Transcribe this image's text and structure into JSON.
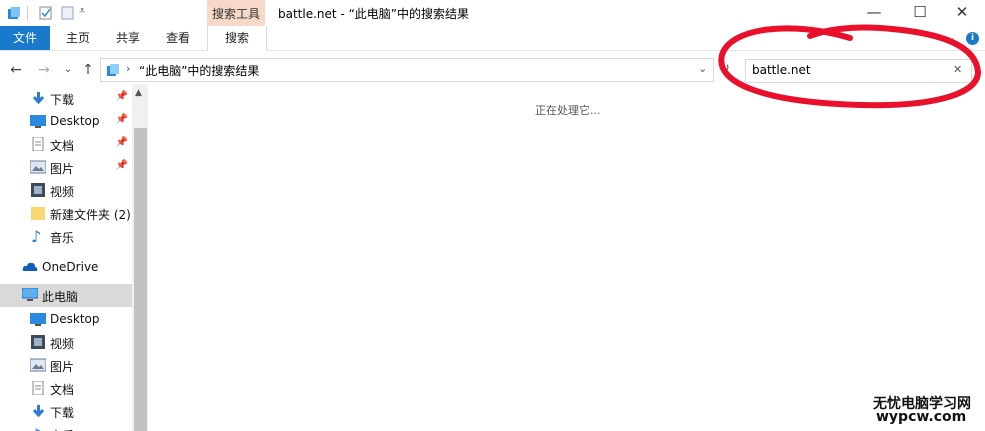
{
  "window": {
    "title": "battle.net - “此电脑”中的搜索结果",
    "context_tab": "搜索工具",
    "controls": {
      "minimize": "—",
      "maximize": "☐",
      "close": "✕"
    }
  },
  "ribbon": {
    "tabs": [
      "文件",
      "主页",
      "共享",
      "查看",
      "搜索"
    ],
    "expand_glyph": "⌄"
  },
  "address": {
    "path": "“此电脑”中的搜索结果",
    "search_value": "battle.net",
    "clear_glyph": "✕"
  },
  "nav_pane": {
    "quick_access": [
      {
        "label": "下载",
        "icon": "download-icon",
        "pinned": true
      },
      {
        "label": "Desktop",
        "icon": "desktop-icon",
        "pinned": true
      },
      {
        "label": "文档",
        "icon": "document-icon",
        "pinned": true
      },
      {
        "label": "图片",
        "icon": "pictures-icon",
        "pinned": true
      },
      {
        "label": "视频",
        "icon": "videos-icon",
        "pinned": false
      },
      {
        "label": "新建文件夹 (2)",
        "icon": "folder-icon",
        "pinned": false
      },
      {
        "label": "音乐",
        "icon": "music-icon",
        "pinned": false
      }
    ],
    "onedrive": "OneDrive",
    "this_pc": "此电脑",
    "this_pc_items": [
      {
        "label": "Desktop",
        "icon": "desktop-icon"
      },
      {
        "label": "视频",
        "icon": "videos-icon"
      },
      {
        "label": "图片",
        "icon": "pictures-icon"
      },
      {
        "label": "文档",
        "icon": "document-icon"
      },
      {
        "label": "下载",
        "icon": "download-icon"
      },
      {
        "label": "音乐",
        "icon": "music-icon"
      }
    ]
  },
  "content": {
    "status": "正在处理它..."
  },
  "watermark": {
    "line1": "无忧电脑学习网",
    "line2": "wypcw.com"
  },
  "colors": {
    "file_tab": "#1979ca",
    "context_tab": "#f7d9c9",
    "annotation": "#e8102a",
    "selected": "#d9d9d9"
  }
}
